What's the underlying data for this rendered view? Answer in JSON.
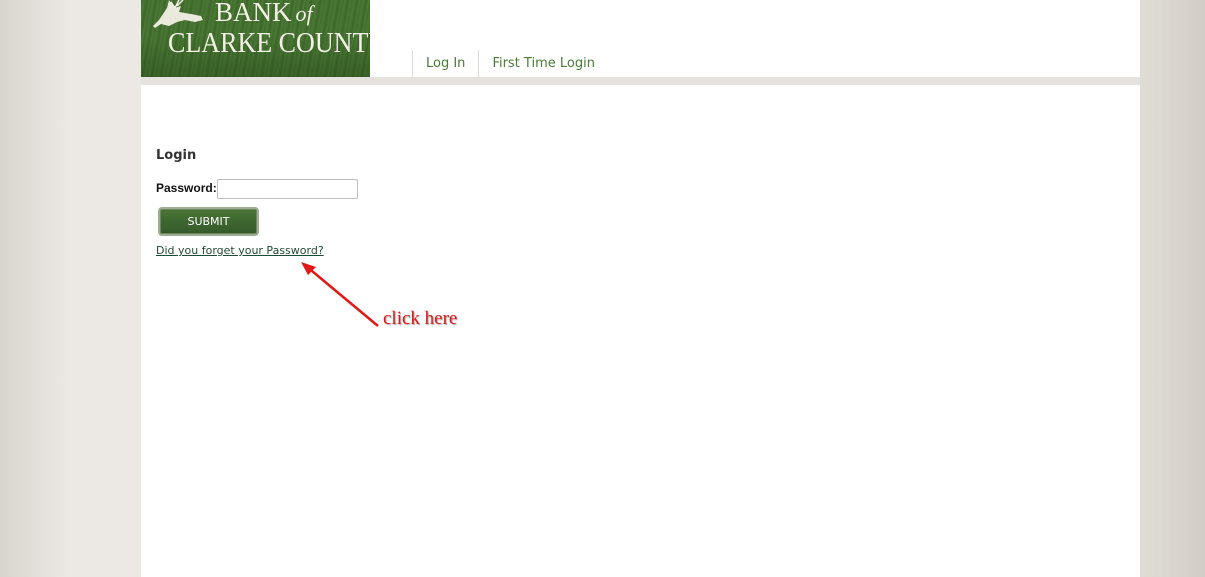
{
  "logo": {
    "line1": "BANK",
    "line1_of": "of",
    "line2": "CLARKE COUNTY"
  },
  "nav": {
    "items": [
      {
        "label": "Log In"
      },
      {
        "label": "First Time Login"
      }
    ]
  },
  "login": {
    "title": "Login",
    "password_label": "Password:",
    "password_value": "",
    "submit_label": "SUBMIT",
    "forgot_link": "Did you forget your Password?"
  },
  "annotation": {
    "text": "click here",
    "color": "#e01818"
  },
  "colors": {
    "brand_green": "#3f6a2c",
    "nav_text": "#4a7a35",
    "link": "#204a38"
  }
}
